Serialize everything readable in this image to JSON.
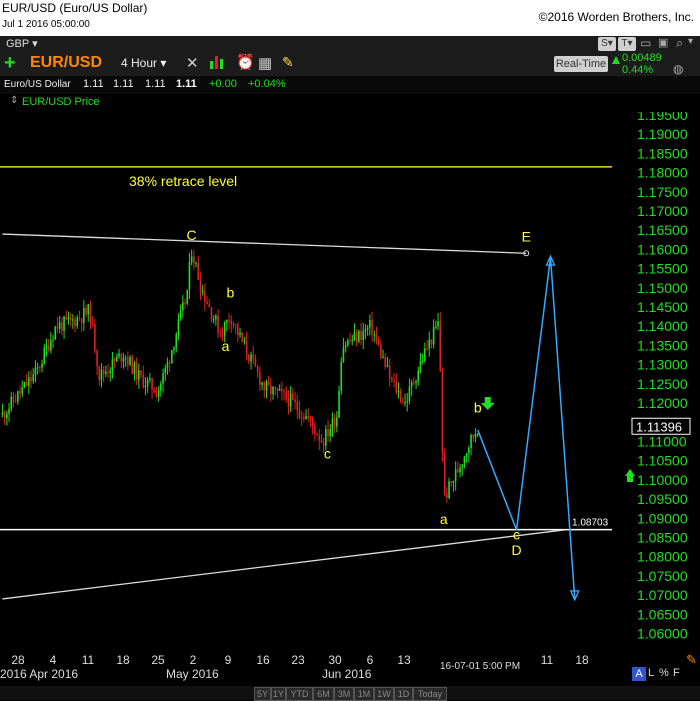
{
  "window": {
    "title": "EUR/USD (Euro/US Dollar)",
    "datetime": "Jul 1 2016 05:00:00",
    "copyright": "©2016 Worden Brothers, Inc."
  },
  "toolbar": {
    "currency": "GBP",
    "symbol": "EUR/USD",
    "interval": "4 Hour",
    "realtime_label": "Real-Time",
    "change_abs": "0.00489",
    "change_pct": "0.44%"
  },
  "quote": {
    "name": "Euro/US Dollar",
    "o": "1.11",
    "h": "1.11",
    "l": "1.11",
    "c": "1.11",
    "chg": "+0.00",
    "chg_pct": "+0.04%"
  },
  "legend": {
    "series": "EUR/USD Price"
  },
  "colors": {
    "up": "#22dd22",
    "down": "#dd2222",
    "annotation": "#ffff33",
    "projection": "#33aaff",
    "background": "#000000"
  },
  "chart_data": {
    "type": "candlestick",
    "ylim": [
      1.057,
      1.197
    ],
    "y_ticks": [
      "1.19500",
      "1.19000",
      "1.18500",
      "1.18000",
      "1.17500",
      "1.17000",
      "1.16500",
      "1.16000",
      "1.15500",
      "1.15000",
      "1.14500",
      "1.14000",
      "1.13500",
      "1.13000",
      "1.12500",
      "1.12000",
      "1.11500",
      "1.11000",
      "1.10500",
      "1.10000",
      "1.09500",
      "1.09000",
      "1.08500",
      "1.08000",
      "1.07500",
      "1.07000",
      "1.06500",
      "1.06000"
    ],
    "x_ticks": [
      "28",
      "4",
      "11",
      "18",
      "25",
      "2",
      "9",
      "16",
      "23",
      "30",
      "6",
      "13",
      "11",
      "18"
    ],
    "x_month_labels": [
      "2016 Apr 2016",
      "May 2016",
      "Jun 2016"
    ],
    "last_bar_label": "16-07-01 5:00 PM",
    "current_price": "1.11396",
    "horizontal_lines": [
      {
        "price": 1.1815,
        "label": "38% retrace level"
      },
      {
        "price": 1.08703,
        "label": "1.08703"
      }
    ],
    "price_path": [
      {
        "date": "Mar 25",
        "price": 1.117
      },
      {
        "date": "Apr 1",
        "price": 1.128
      },
      {
        "date": "Apr 5",
        "price": 1.14
      },
      {
        "date": "Apr 8",
        "price": 1.141
      },
      {
        "date": "Apr 12",
        "price": 1.144
      },
      {
        "date": "Apr 14",
        "price": 1.127
      },
      {
        "date": "Apr 19",
        "price": 1.133
      },
      {
        "date": "Apr 22",
        "price": 1.127
      },
      {
        "date": "Apr 26",
        "price": 1.123
      },
      {
        "date": "Apr 28",
        "price": 1.13
      },
      {
        "date": "May 2",
        "price": 1.148
      },
      {
        "date": "May 3",
        "price": 1.16
      },
      {
        "date": "May 5",
        "price": 1.15
      },
      {
        "date": "May 9",
        "price": 1.138
      },
      {
        "date": "May 11",
        "price": 1.143
      },
      {
        "date": "May 13",
        "price": 1.137
      },
      {
        "date": "May 18",
        "price": 1.124
      },
      {
        "date": "May 23",
        "price": 1.121
      },
      {
        "date": "May 27",
        "price": 1.116
      },
      {
        "date": "May 30",
        "price": 1.11
      },
      {
        "date": "Jun 2",
        "price": 1.117
      },
      {
        "date": "Jun 3",
        "price": 1.135
      },
      {
        "date": "Jun 7",
        "price": 1.138
      },
      {
        "date": "Jun 9",
        "price": 1.14
      },
      {
        "date": "Jun 13",
        "price": 1.126
      },
      {
        "date": "Jun 16",
        "price": 1.12
      },
      {
        "date": "Jun 20",
        "price": 1.133
      },
      {
        "date": "Jun 23",
        "price": 1.141
      },
      {
        "date": "Jun 24",
        "price": 1.095
      },
      {
        "date": "Jun 27",
        "price": 1.103
      },
      {
        "date": "Jun 29",
        "price": 1.109
      },
      {
        "date": "Jul 1",
        "price": 1.114
      }
    ],
    "trendlines": [
      {
        "from": {
          "date": "Mar 25",
          "price": 1.164
        },
        "to": {
          "date": "Jul 11",
          "price": 1.159
        },
        "label": "E"
      },
      {
        "from": {
          "date": "Mar 25",
          "price": 1.069
        },
        "to": {
          "date": "Jul 19",
          "price": 1.087
        }
      }
    ],
    "projection": [
      {
        "date": "Jul 1",
        "price": 1.113
      },
      {
        "date": "Jul 9",
        "price": 1.087
      },
      {
        "date": "Jul 16",
        "price": 1.158
      },
      {
        "date": "Jul 21",
        "price": 1.069
      }
    ],
    "wave_labels": [
      {
        "text": "C",
        "date": "May 3",
        "price": 1.1625
      },
      {
        "text": "b",
        "date": "May 11",
        "price": 1.1475
      },
      {
        "text": "a",
        "date": "May 10",
        "price": 1.1335
      },
      {
        "text": "c",
        "date": "May 31",
        "price": 1.1055
      },
      {
        "text": "a",
        "date": "Jun 24",
        "price": 1.0885
      },
      {
        "text": "b",
        "date": "Jul 1",
        "price": 1.1175
      },
      {
        "text": "c",
        "date": "Jul 9",
        "price": 1.0845
      },
      {
        "text": "D",
        "date": "Jul 9",
        "price": 1.0805
      },
      {
        "text": "E",
        "date": "Jul 11",
        "price": 1.162
      }
    ]
  },
  "bottom": {
    "zoom_buttons": [
      "5Y",
      "1Y",
      "YTD",
      "6M",
      "3M",
      "1M",
      "1W",
      "1D",
      "Today"
    ],
    "axis_mode": "L",
    "pct": "%",
    "f": "F",
    "a_label": "A"
  }
}
